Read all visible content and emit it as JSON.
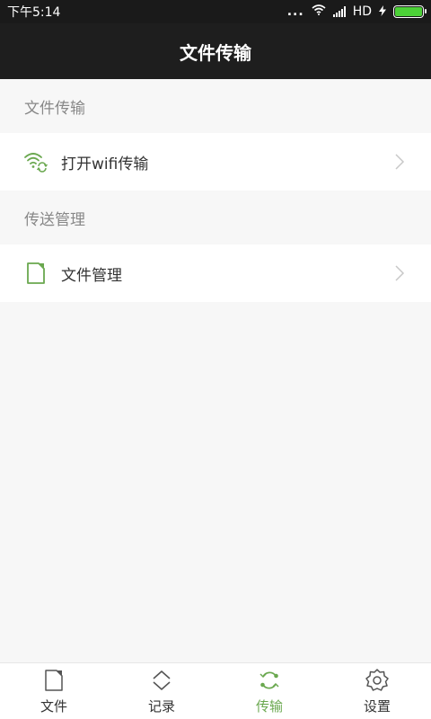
{
  "status_bar": {
    "time": "下午5:14",
    "dots": "...",
    "network": "HD"
  },
  "title": "文件传输",
  "sections": [
    {
      "header": "文件传输",
      "items": [
        {
          "label": "打开wifi传输",
          "icon": "wifi-transfer-icon"
        }
      ]
    },
    {
      "header": "传送管理",
      "items": [
        {
          "label": "文件管理",
          "icon": "document-icon"
        }
      ]
    }
  ],
  "bottom_nav": [
    {
      "label": "文件",
      "icon": "document-icon",
      "active": false
    },
    {
      "label": "记录",
      "icon": "chevrons-up-down-icon",
      "active": false
    },
    {
      "label": "传输",
      "icon": "sync-icon",
      "active": true
    },
    {
      "label": "设置",
      "icon": "gear-icon",
      "active": false
    }
  ],
  "colors": {
    "accent": "#6aa84f",
    "header_bg": "#1e1e1e",
    "page_bg": "#f7f7f7"
  }
}
